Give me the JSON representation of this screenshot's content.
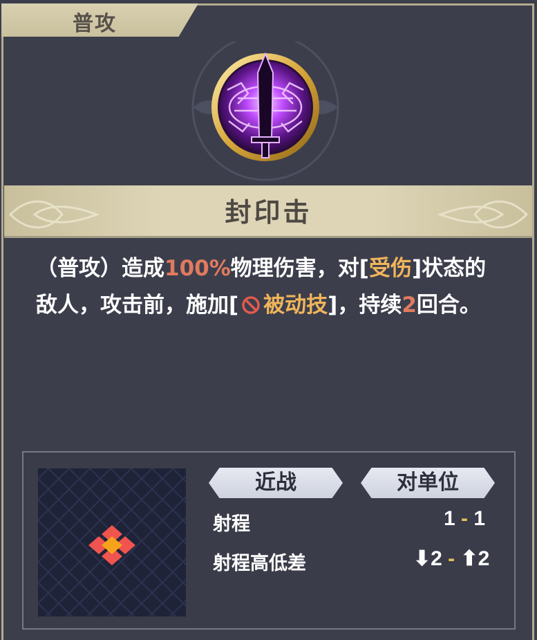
{
  "tab": {
    "label": "普攻"
  },
  "skill": {
    "name": "封印击",
    "icon": "sealed-sword-emblem-icon"
  },
  "description": {
    "p1": "（普攻）造成",
    "damage": "100%",
    "p2": "物理伤害，对[",
    "status": "受伤",
    "p3": "]状态的敌人，攻击前，施加[",
    "debuff_icon": "ban-icon",
    "debuff": "被动技",
    "p4": "]，持续",
    "turns": "2",
    "p5": "回合。"
  },
  "tags": {
    "type": "近战",
    "target": "对单位"
  },
  "stats": {
    "range_label": "射程",
    "range_min": "1",
    "range_sep": "-",
    "range_max": "1",
    "height_label": "射程高低差",
    "height_down": "⬇2",
    "height_sep": "-",
    "height_up": "⬆2"
  },
  "colors": {
    "background": "#3c3e4c",
    "frame": "#c9c09d",
    "highlight_red": "#e07a5f",
    "highlight_gold": "#f0b55a",
    "tile_red": "#f0544e",
    "tile_orange": "#f7a21b"
  }
}
